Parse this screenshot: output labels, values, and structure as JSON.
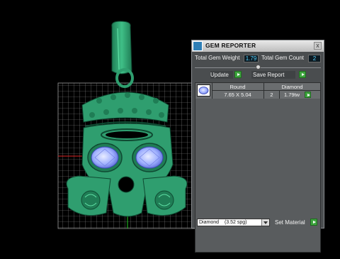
{
  "window": {
    "title": "GEM REPORTER",
    "close_glyph": "x"
  },
  "summary": {
    "total_weight_label": "Total Gem Weight",
    "total_weight_value": "1.79",
    "total_count_label": "Total Gem Count",
    "total_count_value": "2"
  },
  "toolbar": {
    "update_label": "Update",
    "save_report_label": "Save Report"
  },
  "gem_table": {
    "rows": [
      {
        "shape": "Round",
        "size": "7.65 X 5.04",
        "material": "Diamond",
        "count": "2",
        "weight": "1.79tw"
      }
    ]
  },
  "footer": {
    "material_selected": "Diamond",
    "material_spg": "(3.52 spg)",
    "set_material_label": "Set Material"
  },
  "colors": {
    "viewport_bg": "#000000",
    "panel_bg": "#4a4d4f",
    "value_text": "#5ad4ff",
    "go_button": "#3ea43e",
    "model_green": "#2f9e6f",
    "gem_blue": "#b9c6ff"
  }
}
